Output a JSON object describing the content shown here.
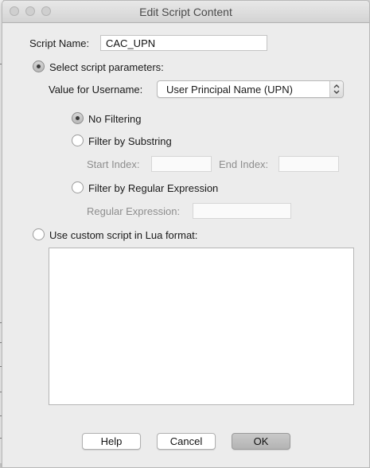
{
  "window": {
    "title": "Edit Script Content"
  },
  "script_name": {
    "label": "Script Name:",
    "value": "CAC_UPN"
  },
  "select_params": {
    "label": "Select script parameters:",
    "selected": true
  },
  "username": {
    "label": "Value for Username:",
    "selected": "User Principal Name (UPN)"
  },
  "filters": {
    "none": {
      "label": "No Filtering",
      "selected": true
    },
    "substring": {
      "label": "Filter by Substring",
      "selected": false
    },
    "start_index_label": "Start Index:",
    "end_index_label": "End Index:",
    "regex": {
      "label": "Filter by Regular Expression",
      "selected": false
    },
    "regex_field_label": "Regular Expression:"
  },
  "custom": {
    "label": "Use custom script in Lua format:",
    "selected": false,
    "content": ""
  },
  "buttons": {
    "help": "Help",
    "cancel": "Cancel",
    "ok": "OK"
  }
}
